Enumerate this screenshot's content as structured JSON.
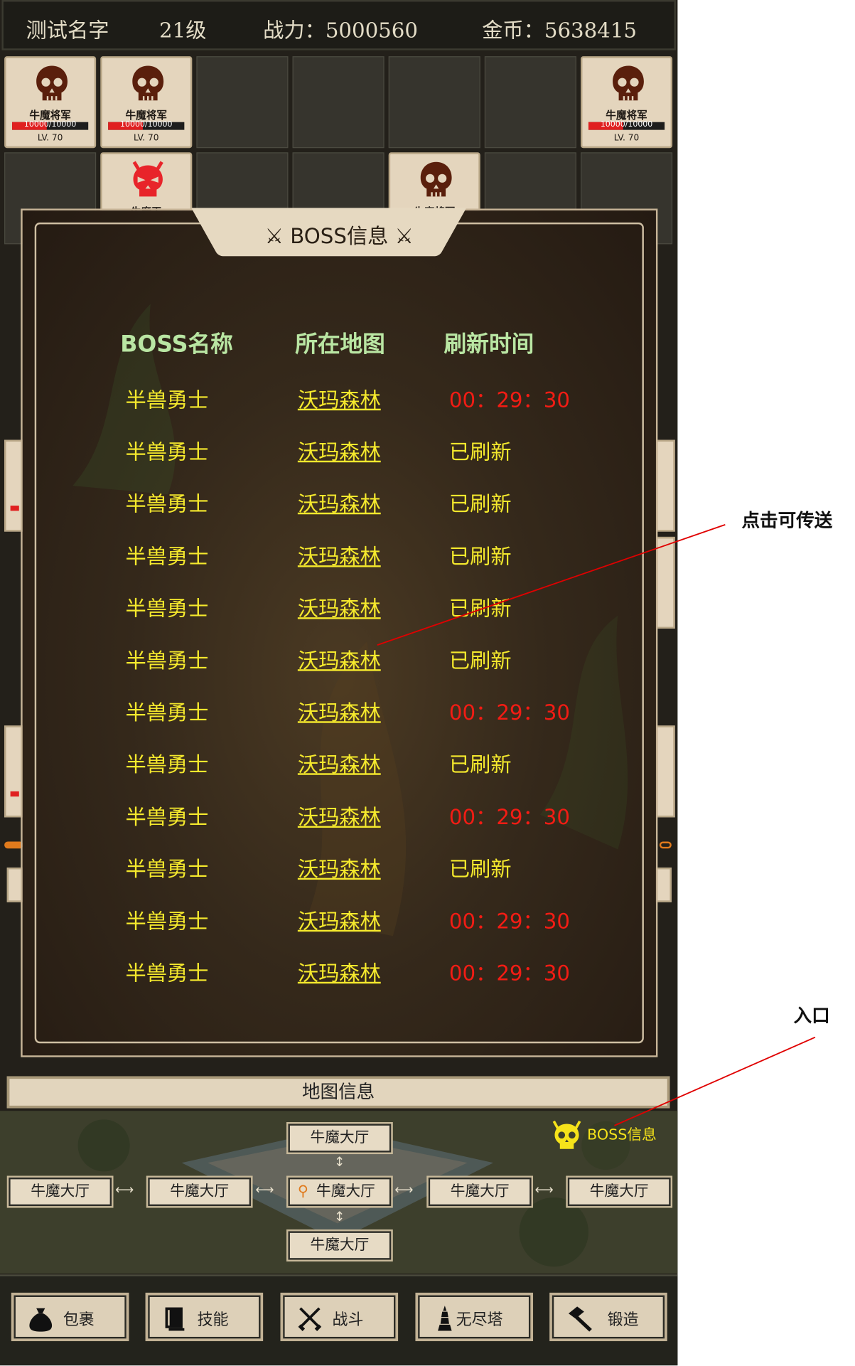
{
  "player": {
    "name": "测试名字",
    "level": "21级",
    "power": "战力：5000560",
    "gold": "金币：5638415"
  },
  "monsters": [
    {
      "name": "牛魔将军",
      "hp": "10000/10000",
      "hp_fraction": 1.0,
      "level": "LV. 70",
      "icon": "skull-icon",
      "color": "#5a1f0c"
    },
    {
      "name": "牛魔将军",
      "hp": "10000/10000",
      "hp_fraction": 1.0,
      "level": "LV. 70",
      "icon": "skull-icon",
      "color": "#5a1f0c"
    },
    {
      "name": "牛魔将军",
      "hp": "10000/10000",
      "hp_fraction": 1.0,
      "level": "LV. 70",
      "icon": "skull-icon",
      "color": "#5a1f0c"
    },
    {
      "name": "牛魔王",
      "icon": "demon-skull-icon",
      "color": "#e8242a"
    },
    {
      "name": "牛魔将军",
      "icon": "skull-icon",
      "color": "#5a1f0c"
    }
  ],
  "boss_panel": {
    "title": "BOSS信息",
    "headers": {
      "name": "BOSS名称",
      "map": "所在地图",
      "refresh": "刷新时间"
    },
    "rows": [
      {
        "name": "半兽勇士",
        "map": "沃玛森林",
        "refresh": "00：29：30",
        "color": "#f21c14"
      },
      {
        "name": "半兽勇士",
        "map": "沃玛森林",
        "refresh": "已刷新",
        "color": "#f5e92d"
      },
      {
        "name": "半兽勇士",
        "map": "沃玛森林",
        "refresh": "已刷新",
        "color": "#f5e92d"
      },
      {
        "name": "半兽勇士",
        "map": "沃玛森林",
        "refresh": "已刷新",
        "color": "#f5e92d"
      },
      {
        "name": "半兽勇士",
        "map": "沃玛森林",
        "refresh": "已刷新",
        "color": "#f5e92d"
      },
      {
        "name": "半兽勇士",
        "map": "沃玛森林",
        "refresh": "已刷新",
        "color": "#f5e92d"
      },
      {
        "name": "半兽勇士",
        "map": "沃玛森林",
        "refresh": "00：29：30",
        "color": "#f21c14"
      },
      {
        "name": "半兽勇士",
        "map": "沃玛森林",
        "refresh": "已刷新",
        "color": "#f5e92d"
      },
      {
        "name": "半兽勇士",
        "map": "沃玛森林",
        "refresh": "00：29：30",
        "color": "#f21c14"
      },
      {
        "name": "半兽勇士",
        "map": "沃玛森林",
        "refresh": "已刷新",
        "color": "#f5e92d"
      },
      {
        "name": "半兽勇士",
        "map": "沃玛森林",
        "refresh": "00：29：30",
        "color": "#f21c14"
      },
      {
        "name": "半兽勇士",
        "map": "沃玛森林",
        "refresh": "00：29：30",
        "color": "#f21c14"
      }
    ]
  },
  "map_info": {
    "title": "地图信息",
    "top": "牛魔大厅",
    "left2": "牛魔大厅",
    "left1": "牛魔大厅",
    "current": "牛魔大厅",
    "right1": "牛魔大厅",
    "right2": "牛魔大厅",
    "bottom": "牛魔大厅",
    "boss_entry": "BOSS信息"
  },
  "nav": [
    {
      "label": "包裹",
      "icon": "bag-icon"
    },
    {
      "label": "技能",
      "icon": "book-icon"
    },
    {
      "label": "战斗",
      "icon": "swords-icon"
    },
    {
      "label": "无尽塔",
      "icon": "tower-icon"
    },
    {
      "label": "锻造",
      "icon": "hammer-icon"
    }
  ],
  "annotations": {
    "teleport": "点击可传送",
    "entry": "入口"
  }
}
